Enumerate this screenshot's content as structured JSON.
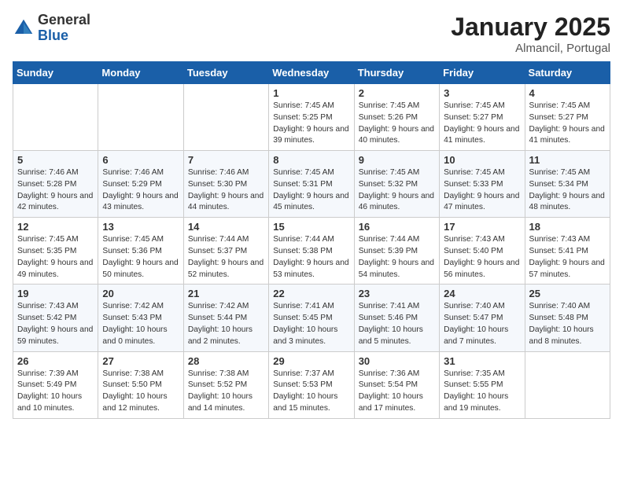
{
  "header": {
    "logo_general": "General",
    "logo_blue": "Blue",
    "month_year": "January 2025",
    "location": "Almancil, Portugal"
  },
  "days_of_week": [
    "Sunday",
    "Monday",
    "Tuesday",
    "Wednesday",
    "Thursday",
    "Friday",
    "Saturday"
  ],
  "weeks": [
    [
      {
        "day": "",
        "content": ""
      },
      {
        "day": "",
        "content": ""
      },
      {
        "day": "",
        "content": ""
      },
      {
        "day": "1",
        "content": "Sunrise: 7:45 AM\nSunset: 5:25 PM\nDaylight: 9 hours\nand 39 minutes."
      },
      {
        "day": "2",
        "content": "Sunrise: 7:45 AM\nSunset: 5:26 PM\nDaylight: 9 hours\nand 40 minutes."
      },
      {
        "day": "3",
        "content": "Sunrise: 7:45 AM\nSunset: 5:27 PM\nDaylight: 9 hours\nand 41 minutes."
      },
      {
        "day": "4",
        "content": "Sunrise: 7:45 AM\nSunset: 5:27 PM\nDaylight: 9 hours\nand 41 minutes."
      }
    ],
    [
      {
        "day": "5",
        "content": "Sunrise: 7:46 AM\nSunset: 5:28 PM\nDaylight: 9 hours\nand 42 minutes."
      },
      {
        "day": "6",
        "content": "Sunrise: 7:46 AM\nSunset: 5:29 PM\nDaylight: 9 hours\nand 43 minutes."
      },
      {
        "day": "7",
        "content": "Sunrise: 7:46 AM\nSunset: 5:30 PM\nDaylight: 9 hours\nand 44 minutes."
      },
      {
        "day": "8",
        "content": "Sunrise: 7:45 AM\nSunset: 5:31 PM\nDaylight: 9 hours\nand 45 minutes."
      },
      {
        "day": "9",
        "content": "Sunrise: 7:45 AM\nSunset: 5:32 PM\nDaylight: 9 hours\nand 46 minutes."
      },
      {
        "day": "10",
        "content": "Sunrise: 7:45 AM\nSunset: 5:33 PM\nDaylight: 9 hours\nand 47 minutes."
      },
      {
        "day": "11",
        "content": "Sunrise: 7:45 AM\nSunset: 5:34 PM\nDaylight: 9 hours\nand 48 minutes."
      }
    ],
    [
      {
        "day": "12",
        "content": "Sunrise: 7:45 AM\nSunset: 5:35 PM\nDaylight: 9 hours\nand 49 minutes."
      },
      {
        "day": "13",
        "content": "Sunrise: 7:45 AM\nSunset: 5:36 PM\nDaylight: 9 hours\nand 50 minutes."
      },
      {
        "day": "14",
        "content": "Sunrise: 7:44 AM\nSunset: 5:37 PM\nDaylight: 9 hours\nand 52 minutes."
      },
      {
        "day": "15",
        "content": "Sunrise: 7:44 AM\nSunset: 5:38 PM\nDaylight: 9 hours\nand 53 minutes."
      },
      {
        "day": "16",
        "content": "Sunrise: 7:44 AM\nSunset: 5:39 PM\nDaylight: 9 hours\nand 54 minutes."
      },
      {
        "day": "17",
        "content": "Sunrise: 7:43 AM\nSunset: 5:40 PM\nDaylight: 9 hours\nand 56 minutes."
      },
      {
        "day": "18",
        "content": "Sunrise: 7:43 AM\nSunset: 5:41 PM\nDaylight: 9 hours\nand 57 minutes."
      }
    ],
    [
      {
        "day": "19",
        "content": "Sunrise: 7:43 AM\nSunset: 5:42 PM\nDaylight: 9 hours\nand 59 minutes."
      },
      {
        "day": "20",
        "content": "Sunrise: 7:42 AM\nSunset: 5:43 PM\nDaylight: 10 hours\nand 0 minutes."
      },
      {
        "day": "21",
        "content": "Sunrise: 7:42 AM\nSunset: 5:44 PM\nDaylight: 10 hours\nand 2 minutes."
      },
      {
        "day": "22",
        "content": "Sunrise: 7:41 AM\nSunset: 5:45 PM\nDaylight: 10 hours\nand 3 minutes."
      },
      {
        "day": "23",
        "content": "Sunrise: 7:41 AM\nSunset: 5:46 PM\nDaylight: 10 hours\nand 5 minutes."
      },
      {
        "day": "24",
        "content": "Sunrise: 7:40 AM\nSunset: 5:47 PM\nDaylight: 10 hours\nand 7 minutes."
      },
      {
        "day": "25",
        "content": "Sunrise: 7:40 AM\nSunset: 5:48 PM\nDaylight: 10 hours\nand 8 minutes."
      }
    ],
    [
      {
        "day": "26",
        "content": "Sunrise: 7:39 AM\nSunset: 5:49 PM\nDaylight: 10 hours\nand 10 minutes."
      },
      {
        "day": "27",
        "content": "Sunrise: 7:38 AM\nSunset: 5:50 PM\nDaylight: 10 hours\nand 12 minutes."
      },
      {
        "day": "28",
        "content": "Sunrise: 7:38 AM\nSunset: 5:52 PM\nDaylight: 10 hours\nand 14 minutes."
      },
      {
        "day": "29",
        "content": "Sunrise: 7:37 AM\nSunset: 5:53 PM\nDaylight: 10 hours\nand 15 minutes."
      },
      {
        "day": "30",
        "content": "Sunrise: 7:36 AM\nSunset: 5:54 PM\nDaylight: 10 hours\nand 17 minutes."
      },
      {
        "day": "31",
        "content": "Sunrise: 7:35 AM\nSunset: 5:55 PM\nDaylight: 10 hours\nand 19 minutes."
      },
      {
        "day": "",
        "content": ""
      }
    ]
  ]
}
